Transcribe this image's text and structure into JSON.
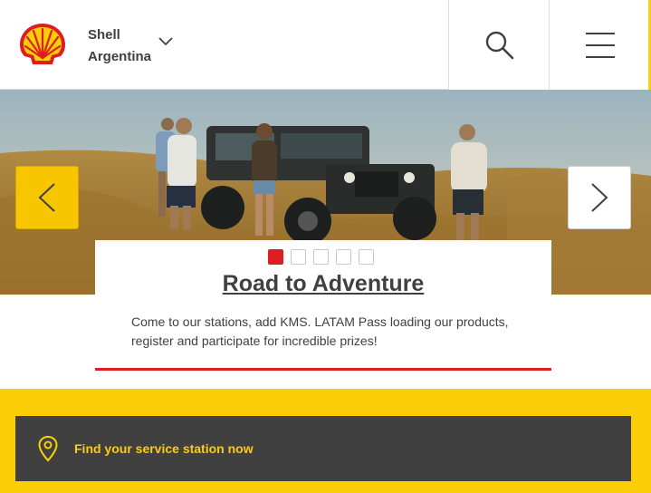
{
  "header": {
    "brand_line1": "Shell",
    "brand_line2": "Argentina",
    "logo_icon": "shell-pecten-logo",
    "search_icon": "search-icon",
    "menu_icon": "hamburger-menu-icon"
  },
  "carousel": {
    "slides_count": 5,
    "active_slide": 1,
    "prev_icon": "chevron-left-icon",
    "next_icon": "chevron-right-icon",
    "title": "Road to Adventure",
    "description": "Come to our stations, add KMS. LATAM Pass loading our products, register and participate for incredible prizes!"
  },
  "station_finder": {
    "label": "Find your service station now",
    "icon": "location-pin-icon"
  },
  "colors": {
    "shell_yellow": "#fbce07",
    "shell_red": "#dd1d21",
    "dark_grey": "#404040"
  }
}
